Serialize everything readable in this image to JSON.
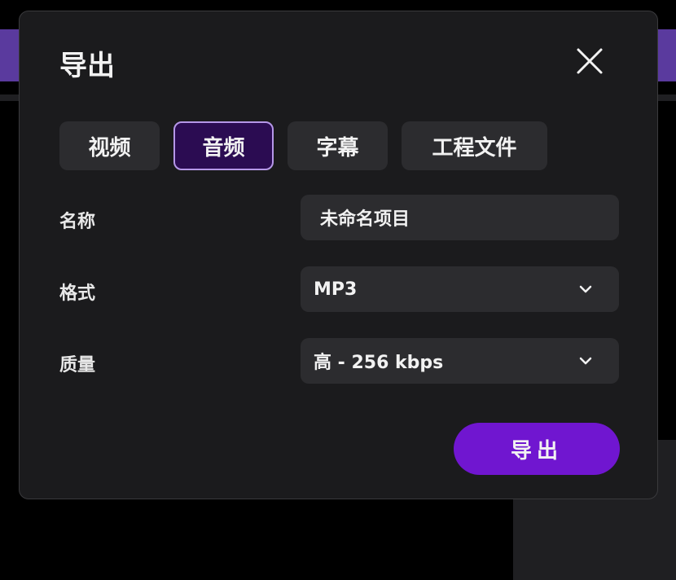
{
  "dialog": {
    "title": "导出",
    "close_icon": "close-icon",
    "tabs": [
      {
        "label": "视频",
        "active": false
      },
      {
        "label": "音频",
        "active": true
      },
      {
        "label": "字幕",
        "active": false
      },
      {
        "label": "工程文件",
        "active": false
      }
    ],
    "fields": {
      "name": {
        "label": "名称",
        "value": "未命名项目"
      },
      "format": {
        "label": "格式",
        "value": "MP3",
        "icon": "chevron-down-icon"
      },
      "quality": {
        "label": "质量",
        "value": "高 - 256 kbps",
        "icon": "chevron-down-icon"
      }
    },
    "export_label": "导出"
  },
  "colors": {
    "accent": "#7016d0",
    "active_tab_bg": "#2b0c52",
    "active_tab_border": "#b597e8",
    "dialog_bg": "#1b1b1d",
    "field_bg": "#2c2c2f",
    "backdrop_bar": "#5a3a9e"
  }
}
